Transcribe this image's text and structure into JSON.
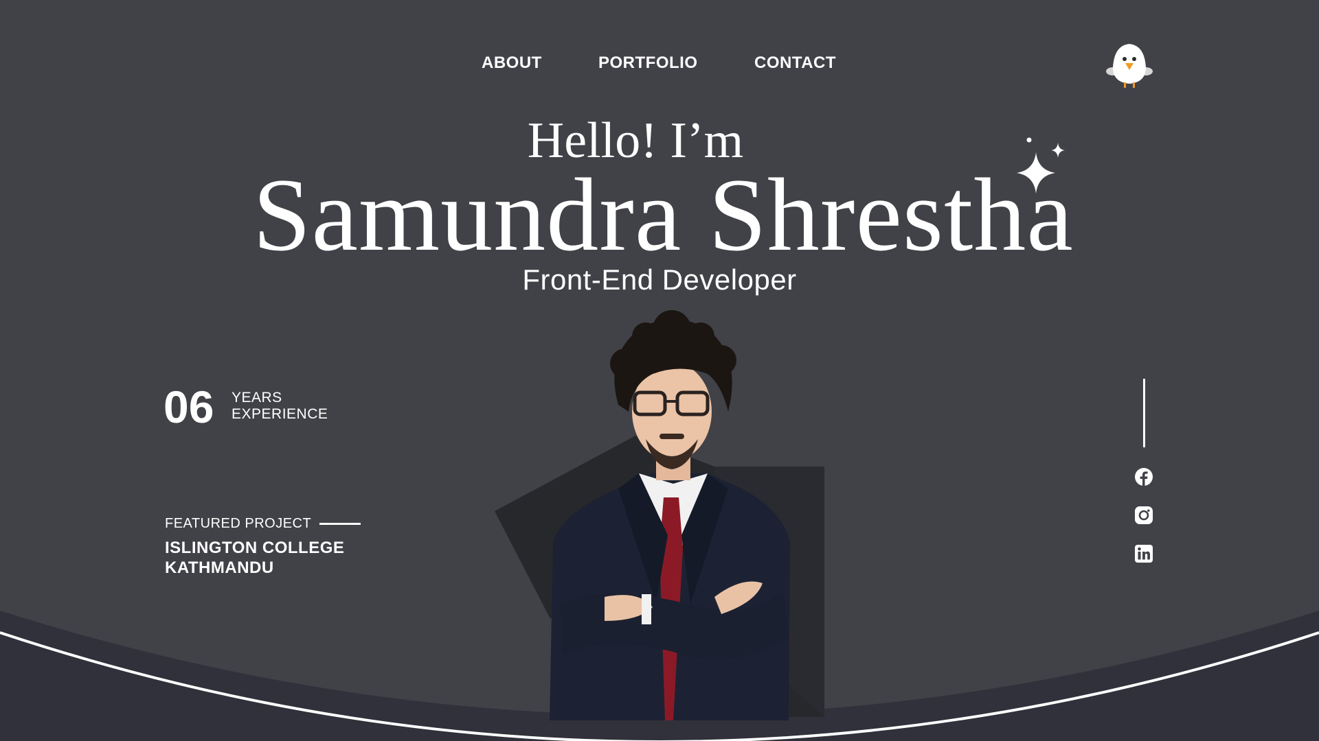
{
  "nav": {
    "about": "ABOUT",
    "portfolio": "PORTFOLIO",
    "contact": "CONTACT"
  },
  "logo": {
    "icon": "bird-mascot-icon"
  },
  "hero": {
    "greeting": "Hello! I’m",
    "name": "Samundra Shrestha",
    "role": "Front-End Developer"
  },
  "experience": {
    "number": "06",
    "label_line1": "YEARS",
    "label_line2": "EXPERIENCE"
  },
  "featured": {
    "label": "FEATURED PROJECT",
    "title_line1": "ISLINGTON COLLEGE",
    "title_line2": "KATHMANDU"
  },
  "social": [
    {
      "icon": "facebook-icon"
    },
    {
      "icon": "instagram-icon"
    },
    {
      "icon": "linkedin-icon"
    }
  ],
  "colors": {
    "background": "#414248",
    "bottom_band": "#30313a",
    "shape_dark": "#27282c",
    "text": "#ffffff"
  }
}
